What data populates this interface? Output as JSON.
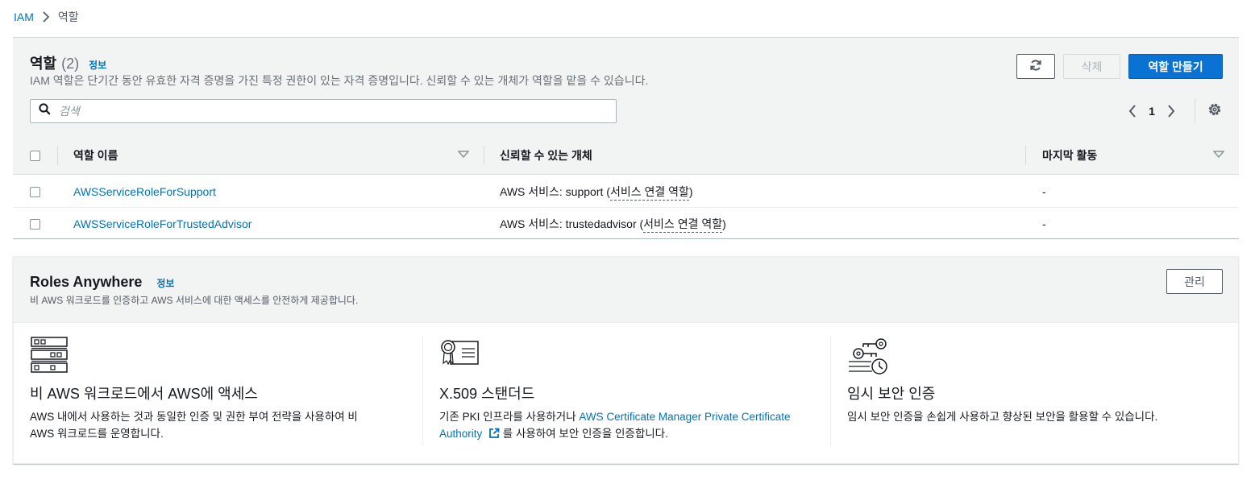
{
  "breadcrumb": {
    "root": "IAM",
    "current": "역할"
  },
  "roles": {
    "title": "역할",
    "count": "(2)",
    "info": "정보",
    "description": "IAM 역할은 단기간 동안 유효한 자격 증명을 가진 특정 권한이 있는 자격 증명입니다. 신뢰할 수 있는 개체가 역할을 맡을 수 있습니다.",
    "delete_label": "삭제",
    "create_label": "역할 만들기",
    "search_placeholder": "검색",
    "page_number": "1",
    "columns": {
      "name": "역할 이름",
      "trusted": "신뢰할 수 있는 개체",
      "last_activity": "마지막 활동"
    },
    "rows": [
      {
        "name": "AWSServiceRoleForSupport",
        "trusted_prefix": "AWS 서비스: support (",
        "trusted_link": "서비스 연결 역할",
        "trusted_suffix": ")",
        "last_activity": "-"
      },
      {
        "name": "AWSServiceRoleForTrustedAdvisor",
        "trusted_prefix": "AWS 서비스: trustedadvisor (",
        "trusted_link": "서비스 연결 역할",
        "trusted_suffix": ")",
        "last_activity": "-"
      }
    ]
  },
  "roles_anywhere": {
    "title": "Roles Anywhere",
    "info": "정보",
    "description": "비 AWS 워크로드를 인증하고 AWS 서비스에 대한 액세스를 안전하게 제공합니다.",
    "manage_label": "관리",
    "features": [
      {
        "title": "비 AWS 워크로드에서 AWS에 액세스",
        "desc_line1": "AWS 내에서 사용하는 것과 동일한 인증 및 권한 부여 전략을 사용하여 비",
        "desc_line2": "AWS 워크로드를 운영합니다.",
        "icon": "server-rack-icon"
      },
      {
        "title": "X.509 스탠더드",
        "desc_prefix": "기존 PKI 인프라를 사용하거나 ",
        "desc_link_line1": "AWS Certificate Manager Private Certificate",
        "desc_link_line2": "Authority",
        "desc_suffix": " 를 사용하여 보안 인증을 인증합니다.",
        "icon": "certificate-icon"
      },
      {
        "title": "임시 보안 인증",
        "desc_line1": "임시 보안 인증을 손쉽게 사용하고 향상된 보안을 활용할 수 있습니다.",
        "icon": "keys-clock-icon"
      }
    ]
  },
  "colors": {
    "link": "#0073bb",
    "primary_button": "#0972d3",
    "header_bg": "#f2f3f3"
  }
}
